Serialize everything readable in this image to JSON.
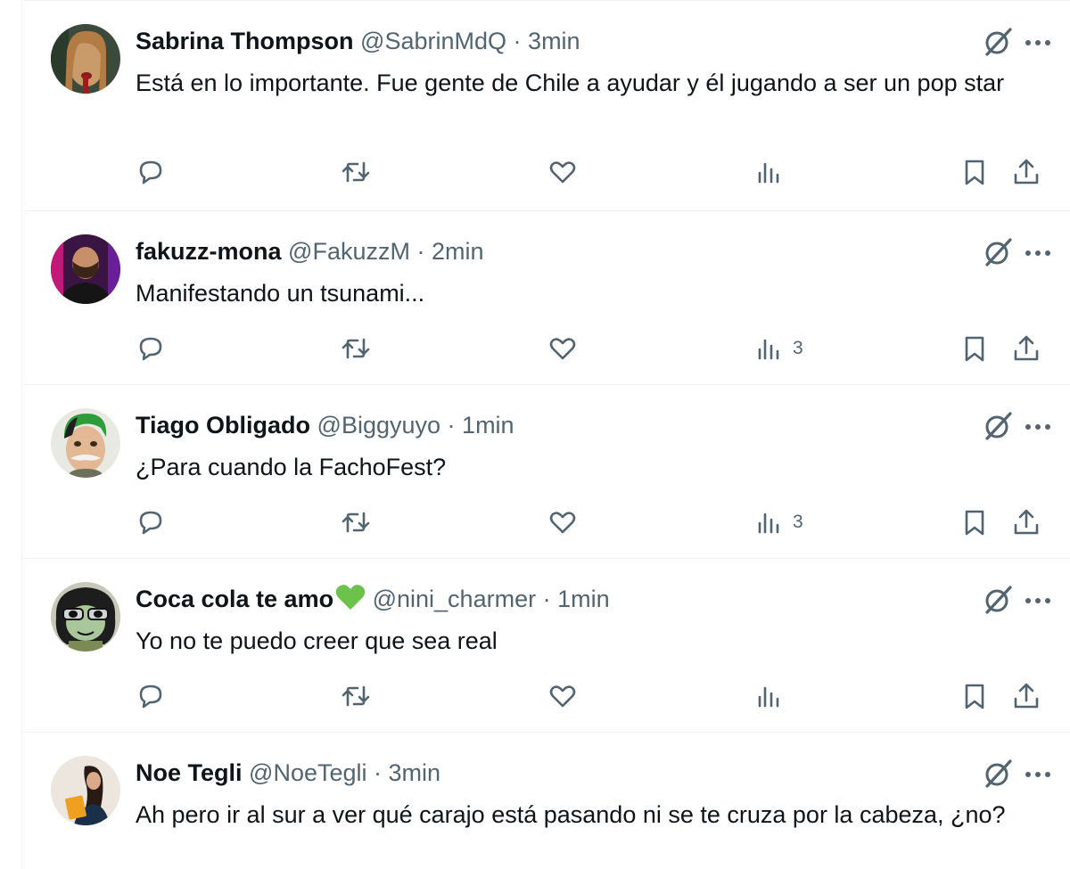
{
  "colors": {
    "text_primary": "#0f1419",
    "text_secondary": "#536471",
    "divider": "#eff3f4",
    "heart_emoji": "#6cc24a"
  },
  "separator": "·",
  "tweets": [
    {
      "name": "Sabrina Thompson",
      "handle": "@SabrinMdQ",
      "time": "3min",
      "text": "Está en lo importante. Fue gente de Chile a ayudar y él jugando a ser un pop star",
      "views": "",
      "avatar_icon": "avatar-photo"
    },
    {
      "name": "fakuzz-mona",
      "handle": "@FakuzzM",
      "time": "2min",
      "text": "Manifestando un tsunami...",
      "views": "3",
      "avatar_icon": "avatar-photo"
    },
    {
      "name": "Tiago Obligado",
      "handle": "@Biggyuyo",
      "time": "1min",
      "text": "¿Para cuando la FachoFest?",
      "views": "3",
      "avatar_icon": "avatar-cartoon"
    },
    {
      "name": "Coca cola te amo",
      "handle": "@nini_charmer",
      "time": "1min",
      "text": "Yo no te puedo creer que sea real",
      "views": "",
      "avatar_icon": "avatar-cartoon"
    },
    {
      "name": "Noe Tegli",
      "handle": "@NoeTegli",
      "time": "3min",
      "text": "Ah pero ir al sur a ver qué carajo está pasando ni se te cruza por la cabeza, ¿no?",
      "views": "",
      "avatar_icon": "avatar-photo"
    }
  ],
  "icons": {
    "grok": "grok-icon",
    "more": "more-icon",
    "reply": "reply-icon",
    "retweet": "retweet-icon",
    "like": "like-icon",
    "views": "views-icon",
    "bookmark": "bookmark-icon",
    "share": "share-icon",
    "emoji": "green-heart-emoji"
  }
}
